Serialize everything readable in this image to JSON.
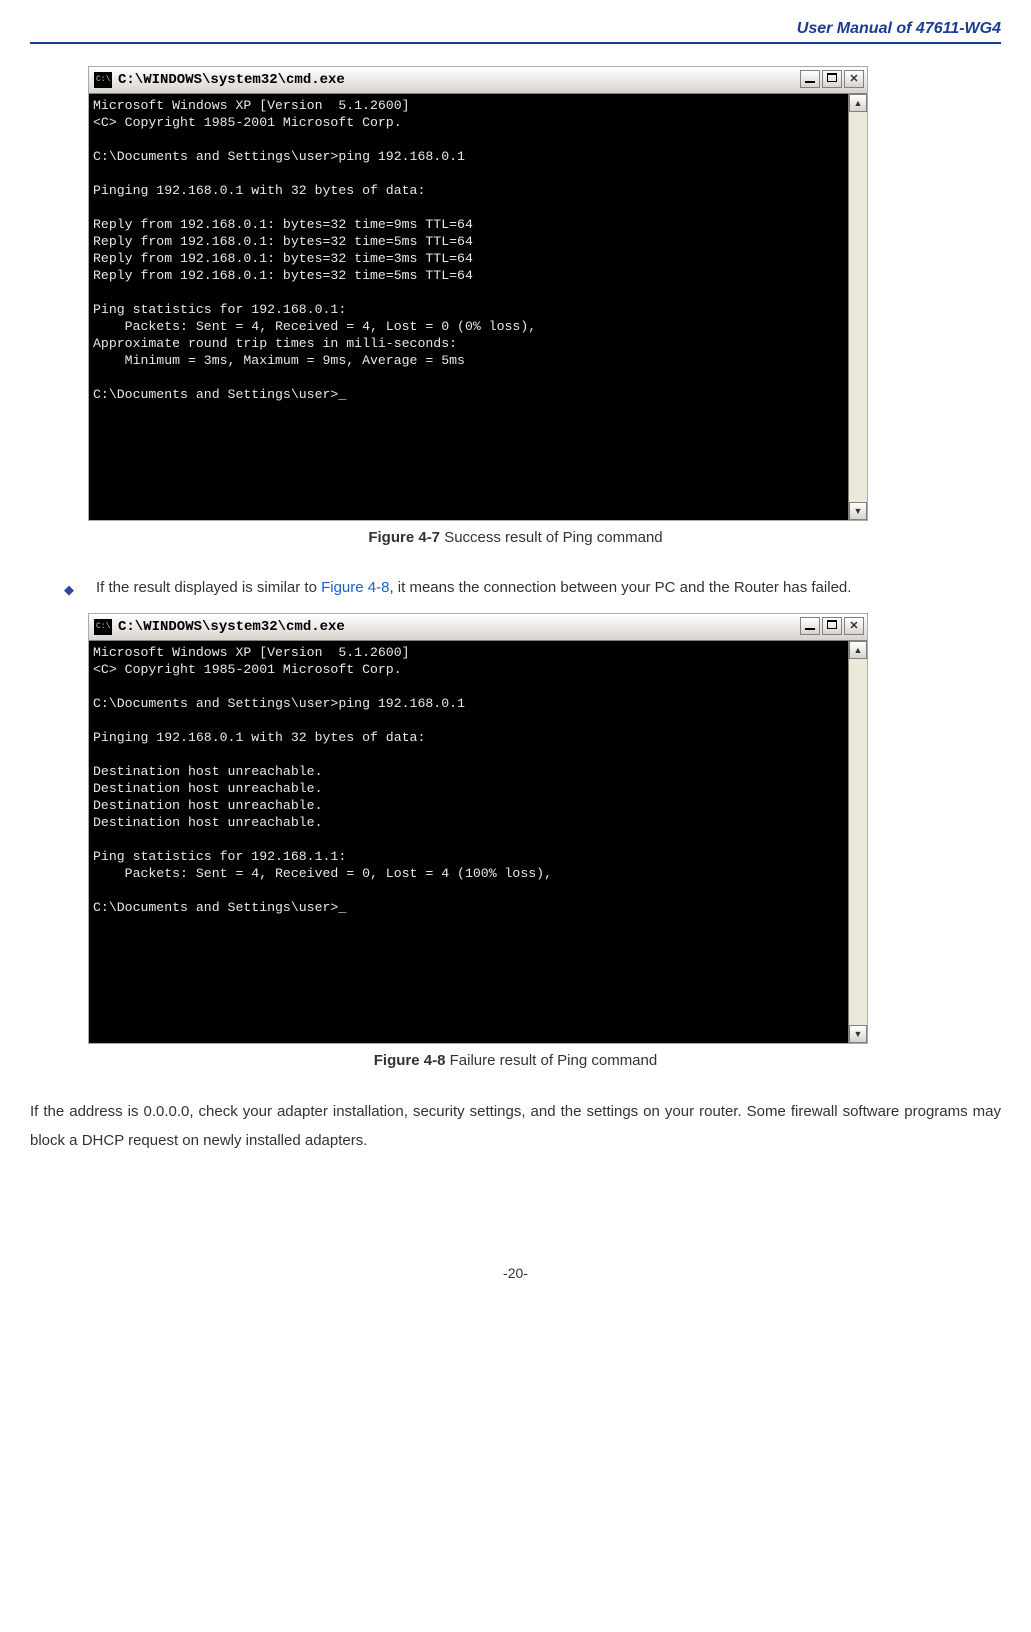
{
  "header": {
    "title": "User Manual of 47611-WG4"
  },
  "cmd1": {
    "title": "C:\\WINDOWS\\system32\\cmd.exe",
    "lines": "Microsoft Windows XP [Version  5.1.2600]\n<C> Copyright 1985-2001 Microsoft Corp.\n\nC:\\Documents and Settings\\user>ping 192.168.0.1\n\nPinging 192.168.0.1 with 32 bytes of data:\n\nReply from 192.168.0.1: bytes=32 time=9ms TTL=64\nReply from 192.168.0.1: bytes=32 time=5ms TTL=64\nReply from 192.168.0.1: bytes=32 time=3ms TTL=64\nReply from 192.168.0.1: bytes=32 time=5ms TTL=64\n\nPing statistics for 192.168.0.1:\n    Packets: Sent = 4, Received = 4, Lost = 0 (0% loss),\nApproximate round trip times in milli-seconds:\n    Minimum = 3ms, Maximum = 9ms, Average = 5ms\n\nC:\\Documents and Settings\\user>_"
  },
  "caption1": {
    "bold": "Figure 4-7",
    "text": "  Success result of Ping command"
  },
  "bullet": {
    "pre": "If the result displayed is similar to ",
    "link": "Figure 4-8",
    "post": ", it means the connection between your PC and the Router has failed."
  },
  "cmd2": {
    "title": "C:\\WINDOWS\\system32\\cmd.exe",
    "lines": "Microsoft Windows XP [Version  5.1.2600]\n<C> Copyright 1985-2001 Microsoft Corp.\n\nC:\\Documents and Settings\\user>ping 192.168.0.1\n\nPinging 192.168.0.1 with 32 bytes of data:\n\nDestination host unreachable.\nDestination host unreachable.\nDestination host unreachable.\nDestination host unreachable.\n\nPing statistics for 192.168.1.1:\n    Packets: Sent = 4, Received = 0, Lost = 4 (100% loss),\n\nC:\\Documents and Settings\\user>_"
  },
  "caption2": {
    "bold": "Figure 4-8",
    "text": "  Failure result of Ping command"
  },
  "para": "If the address is 0.0.0.0, check your adapter installation, security settings, and the settings on your router. Some firewall software programs may block a DHCP request on newly installed adapters.",
  "footer": "-20-",
  "scroll": {
    "up": "▲",
    "down": "▼"
  }
}
